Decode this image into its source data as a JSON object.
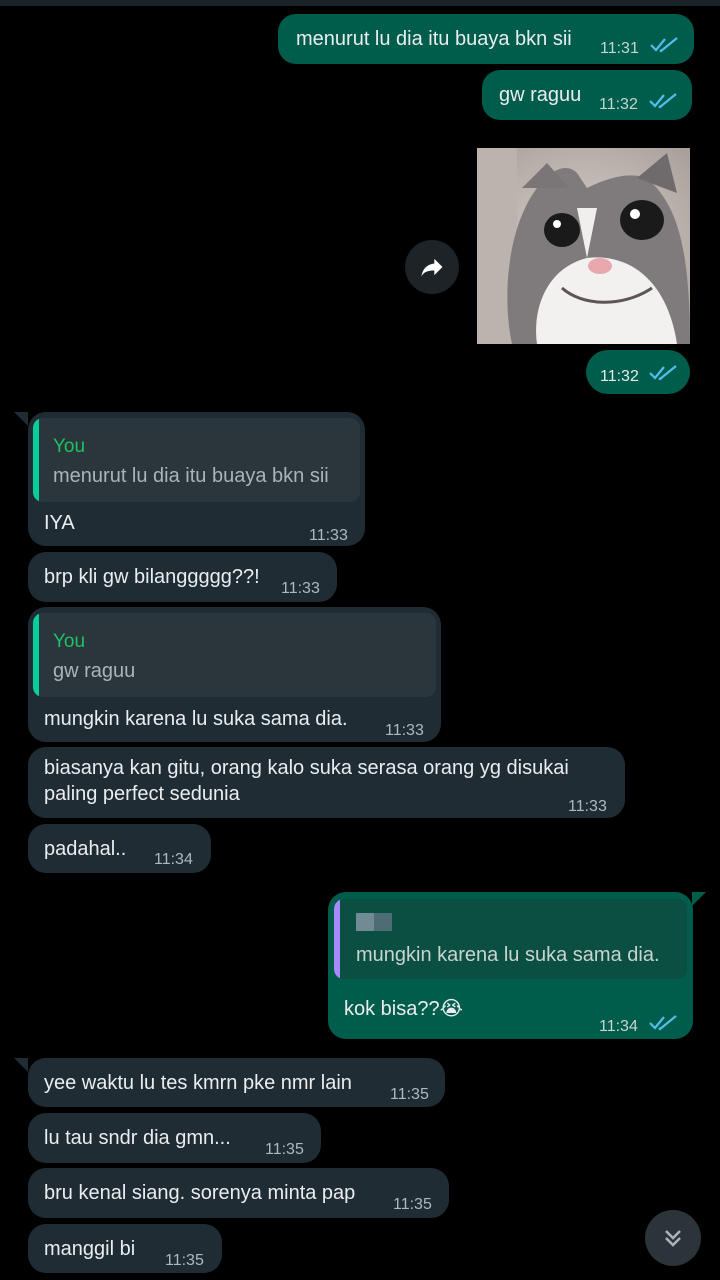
{
  "messages": [
    {
      "direction": "out",
      "text": "menurut lu dia itu buaya bkn sii",
      "time": "11:31",
      "status": "read"
    },
    {
      "direction": "out",
      "text": "gw raguu",
      "time": "11:32",
      "status": "read"
    },
    {
      "direction": "out",
      "type": "image",
      "image": "cat-smiling-photo",
      "time": "11:32",
      "status": "read"
    },
    {
      "direction": "in",
      "quote": {
        "author": "You",
        "text": "menurut lu dia itu buaya bkn sii"
      },
      "text": "IYA",
      "time": "11:33"
    },
    {
      "direction": "in",
      "text": "brp kli gw bilanggggg??!",
      "time": "11:33"
    },
    {
      "direction": "in",
      "quote": {
        "author": "You",
        "text": "gw raguu"
      },
      "text": "mungkin karena lu suka sama dia.",
      "time": "11:33"
    },
    {
      "direction": "in",
      "lines": [
        "biasanya kan gitu, orang kalo suka serasa orang yg disukai",
        "paling perfect sedunia"
      ],
      "time": "11:33"
    },
    {
      "direction": "in",
      "text": "padahal..",
      "time": "11:34"
    },
    {
      "direction": "out",
      "quote": {
        "author": "",
        "text": "mungkin karena lu suka sama dia."
      },
      "text": "kok bisa??😭",
      "time": "11:34",
      "status": "read"
    },
    {
      "direction": "in",
      "text": "yee waktu lu tes kmrn pke nmr lain",
      "time": "11:35"
    },
    {
      "direction": "in",
      "text": "lu tau sndr dia gmn...",
      "time": "11:35"
    },
    {
      "direction": "in",
      "text": "bru kenal siang. sorenya minta pap",
      "time": "11:35"
    },
    {
      "direction": "in",
      "text": "manggil bi",
      "time": "11:35"
    }
  ],
  "icons": {
    "read_ticks": "double-check-icon",
    "forward": "forward-arrow-icon",
    "scroll_down": "chevron-double-down-icon"
  },
  "colors": {
    "background": "#000000",
    "outgoing_bubble": "#005c4b",
    "incoming_bubble": "#202c33",
    "read_ticks": "#53bdeb",
    "quote_author": "#21c063",
    "quote_bar_in": "#06cf9c",
    "quote_bar_out": "#a78bfa"
  }
}
